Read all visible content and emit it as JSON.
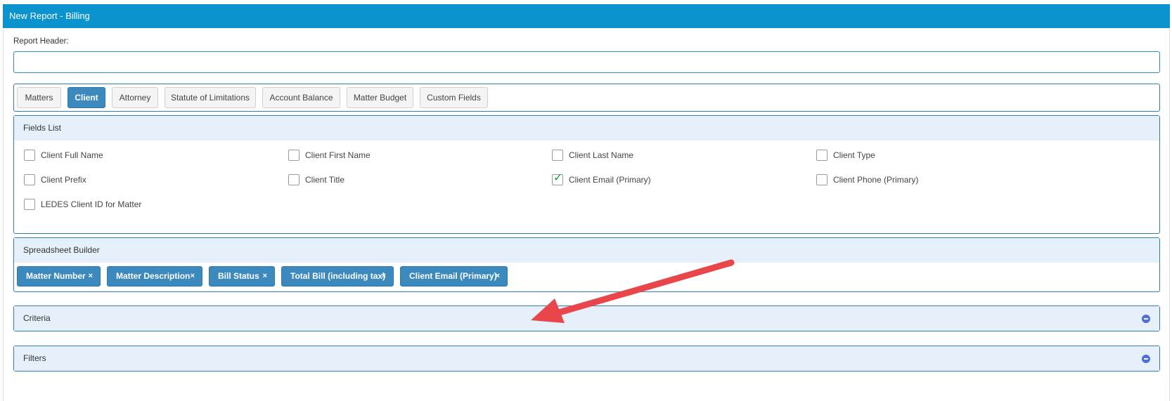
{
  "window": {
    "title": "New Report -  Billing"
  },
  "report_header": {
    "label": "Report Header:",
    "value": "",
    "placeholder": ""
  },
  "tabs": [
    {
      "label": "Matters",
      "active": false
    },
    {
      "label": "Client",
      "active": true
    },
    {
      "label": "Attorney",
      "active": false
    },
    {
      "label": "Statute of Limitations",
      "active": false
    },
    {
      "label": "Account Balance",
      "active": false
    },
    {
      "label": "Matter Budget",
      "active": false
    },
    {
      "label": "Custom Fields",
      "active": false
    }
  ],
  "fields_list": {
    "title": "Fields List",
    "fields": [
      {
        "label": "Client Full Name",
        "checked": false
      },
      {
        "label": "Client First Name",
        "checked": false
      },
      {
        "label": "Client Last Name",
        "checked": false
      },
      {
        "label": "Client Type",
        "checked": false
      },
      {
        "label": "Client Prefix",
        "checked": false
      },
      {
        "label": "Client Title",
        "checked": false
      },
      {
        "label": "Client Email (Primary)",
        "checked": true
      },
      {
        "label": "Client Phone (Primary)",
        "checked": false
      },
      {
        "label": "LEDES Client ID for Matter",
        "checked": false
      }
    ]
  },
  "spreadsheet_builder": {
    "title": "Spreadsheet Builder",
    "columns": [
      {
        "label": "Matter Number",
        "remove": "×"
      },
      {
        "label": "Matter Description",
        "remove": "×"
      },
      {
        "label": "Bill Status",
        "remove": "×"
      },
      {
        "label": "Total Bill (including tax)",
        "remove": "×"
      },
      {
        "label": "Client Email (Primary)",
        "remove": "×"
      }
    ]
  },
  "criteria": {
    "title": "Criteria"
  },
  "filters": {
    "title": "Filters"
  },
  "colors": {
    "titlebar": "#0a93cd",
    "accent": "#3b89bd",
    "panel_header": "#e6f0fa",
    "annotation_arrow": "#e8464a",
    "check": "#1a9a4a"
  },
  "icons": {
    "collapse": "minus-circle-icon",
    "remove": "close-icon",
    "check": "checkmark-icon"
  }
}
